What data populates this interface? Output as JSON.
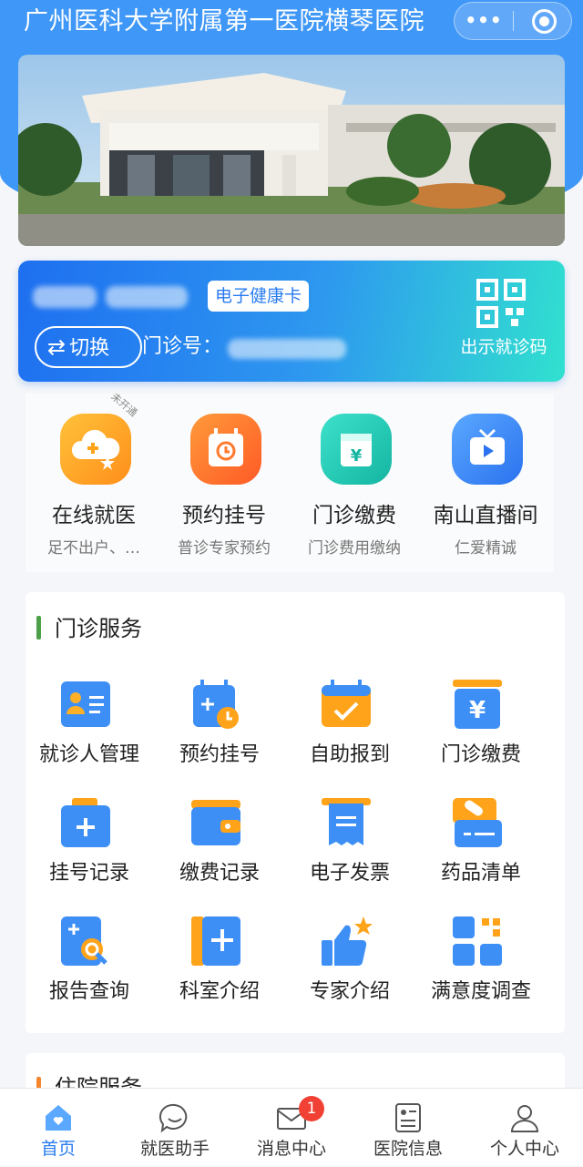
{
  "app": {
    "title": "广州医科大学附属第一医院横琴医院"
  },
  "capsule": {
    "more": "•••",
    "close_icon": "target-icon"
  },
  "health_card": {
    "ehc_label": "电子健康卡",
    "switch_label": "切换",
    "clinic_no_label": "门诊号：",
    "show_code_label": "出示就诊码"
  },
  "quick_entries": [
    {
      "title": "在线就医",
      "subtitle": "足不出户、…",
      "tag": "未开通",
      "icon": "cloud-plus-icon",
      "color": "#ffa31a"
    },
    {
      "title": "预约挂号",
      "subtitle": "普诊专家预约",
      "icon": "calendar-clock-icon",
      "color": "#ff7a2e"
    },
    {
      "title": "门诊缴费",
      "subtitle": "门诊费用缴纳",
      "icon": "yuan-card-icon",
      "color": "#22c9b4"
    },
    {
      "title": "南山直播间",
      "subtitle": "仁爱精诚",
      "icon": "tv-play-icon",
      "color": "#3d8ff6"
    }
  ],
  "outpatient_section": {
    "title": "门诊服务",
    "items": [
      {
        "label": "就诊人管理",
        "icon": "id-card-icon"
      },
      {
        "label": "预约挂号",
        "icon": "calendar-clock-icon"
      },
      {
        "label": "自助报到",
        "icon": "calendar-check-icon"
      },
      {
        "label": "门诊缴费",
        "icon": "yuan-icon"
      },
      {
        "label": "挂号记录",
        "icon": "medical-folder-icon"
      },
      {
        "label": "缴费记录",
        "icon": "wallet-icon"
      },
      {
        "label": "电子发票",
        "icon": "invoice-icon"
      },
      {
        "label": "药品清单",
        "icon": "pill-icon"
      },
      {
        "label": "报告查询",
        "icon": "report-search-icon"
      },
      {
        "label": "科室介绍",
        "icon": "department-book-icon"
      },
      {
        "label": "专家介绍",
        "icon": "thumbs-up-star-icon"
      },
      {
        "label": "满意度调查",
        "icon": "grid-icon"
      }
    ]
  },
  "inpatient_section": {
    "title": "住院服务"
  },
  "tabbar": [
    {
      "label": "首页",
      "icon": "home-icon",
      "active": true
    },
    {
      "label": "就医助手",
      "icon": "chat-icon"
    },
    {
      "label": "消息中心",
      "icon": "mail-icon",
      "badge": "1"
    },
    {
      "label": "医院信息",
      "icon": "info-doc-icon"
    },
    {
      "label": "个人中心",
      "icon": "user-icon"
    }
  ],
  "colors": {
    "primary": "#3f97f7",
    "accent_blue": "#2a7cf0",
    "section_bar": "#4ca048",
    "badge": "#f04134"
  }
}
